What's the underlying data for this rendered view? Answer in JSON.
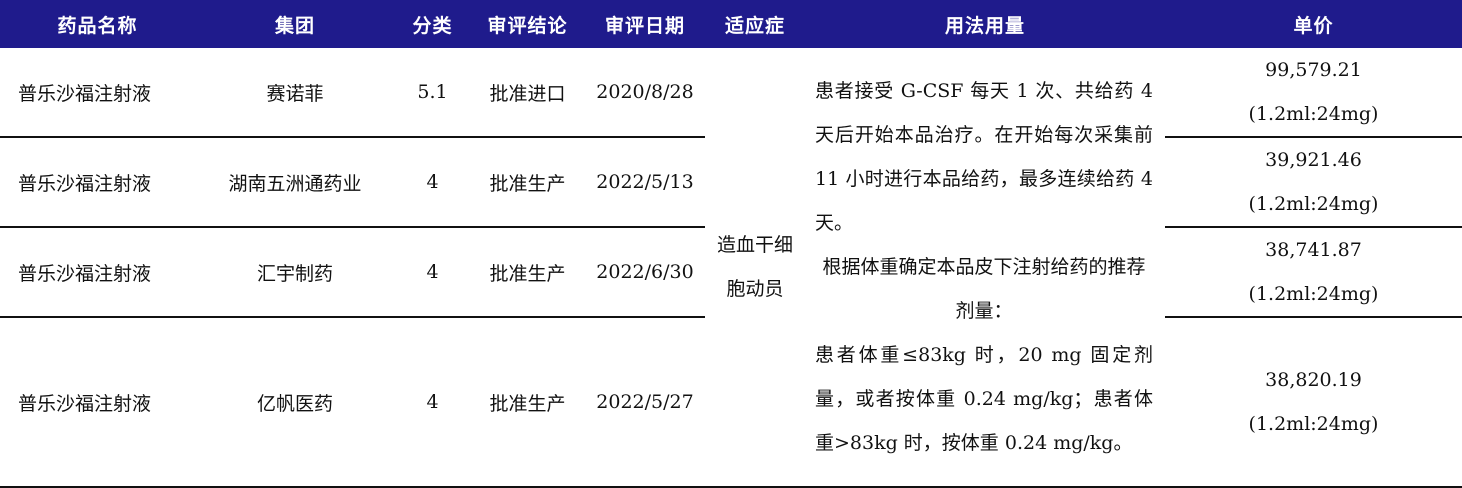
{
  "headers": [
    "药品名称",
    "集团",
    "分类",
    "审评结论",
    "审评日期",
    "适应症",
    "用法用量",
    "单价"
  ],
  "rows": [
    {
      "name": "普乐沙福注射液",
      "group": "赛诺菲",
      "class": "5.1",
      "conclusion": "批准进口",
      "date": "2020/8/28",
      "price": "99,579.21",
      "spec": "(1.2ml:24mg)"
    },
    {
      "name": "普乐沙福注射液",
      "group": "湖南五洲通药业",
      "class": "4",
      "conclusion": "批准生产",
      "date": "2022/5/13",
      "price": "39,921.46",
      "spec": "(1.2ml:24mg)"
    },
    {
      "name": "普乐沙福注射液",
      "group": "汇宇制药",
      "class": "4",
      "conclusion": "批准生产",
      "date": "2022/6/30",
      "price": "38,741.87",
      "spec": "(1.2ml:24mg)"
    },
    {
      "name": "普乐沙福注射液",
      "group": "亿帆医药",
      "class": "4",
      "conclusion": "批准生产",
      "date": "2022/5/27",
      "price": "38,820.19",
      "spec": "(1.2ml:24mg)"
    }
  ],
  "indication": {
    "line1": "造血干细",
    "line2": "胞动员"
  },
  "usage": {
    "p1": "患者接受 G-CSF 每天 1 次、共给药 4 天后开始本品治疗。在开始每次采集前 11 小时进行本品给药，最多连续给药 4 天。",
    "p2": "根据体重确定本品皮下注射给药的推荐剂量：",
    "p3": "患者体重≤83kg 时，20 mg 固定剂量，或者按体重 0.24 mg/kg；患者体重>83kg 时，按体重 0.24 mg/kg。"
  }
}
